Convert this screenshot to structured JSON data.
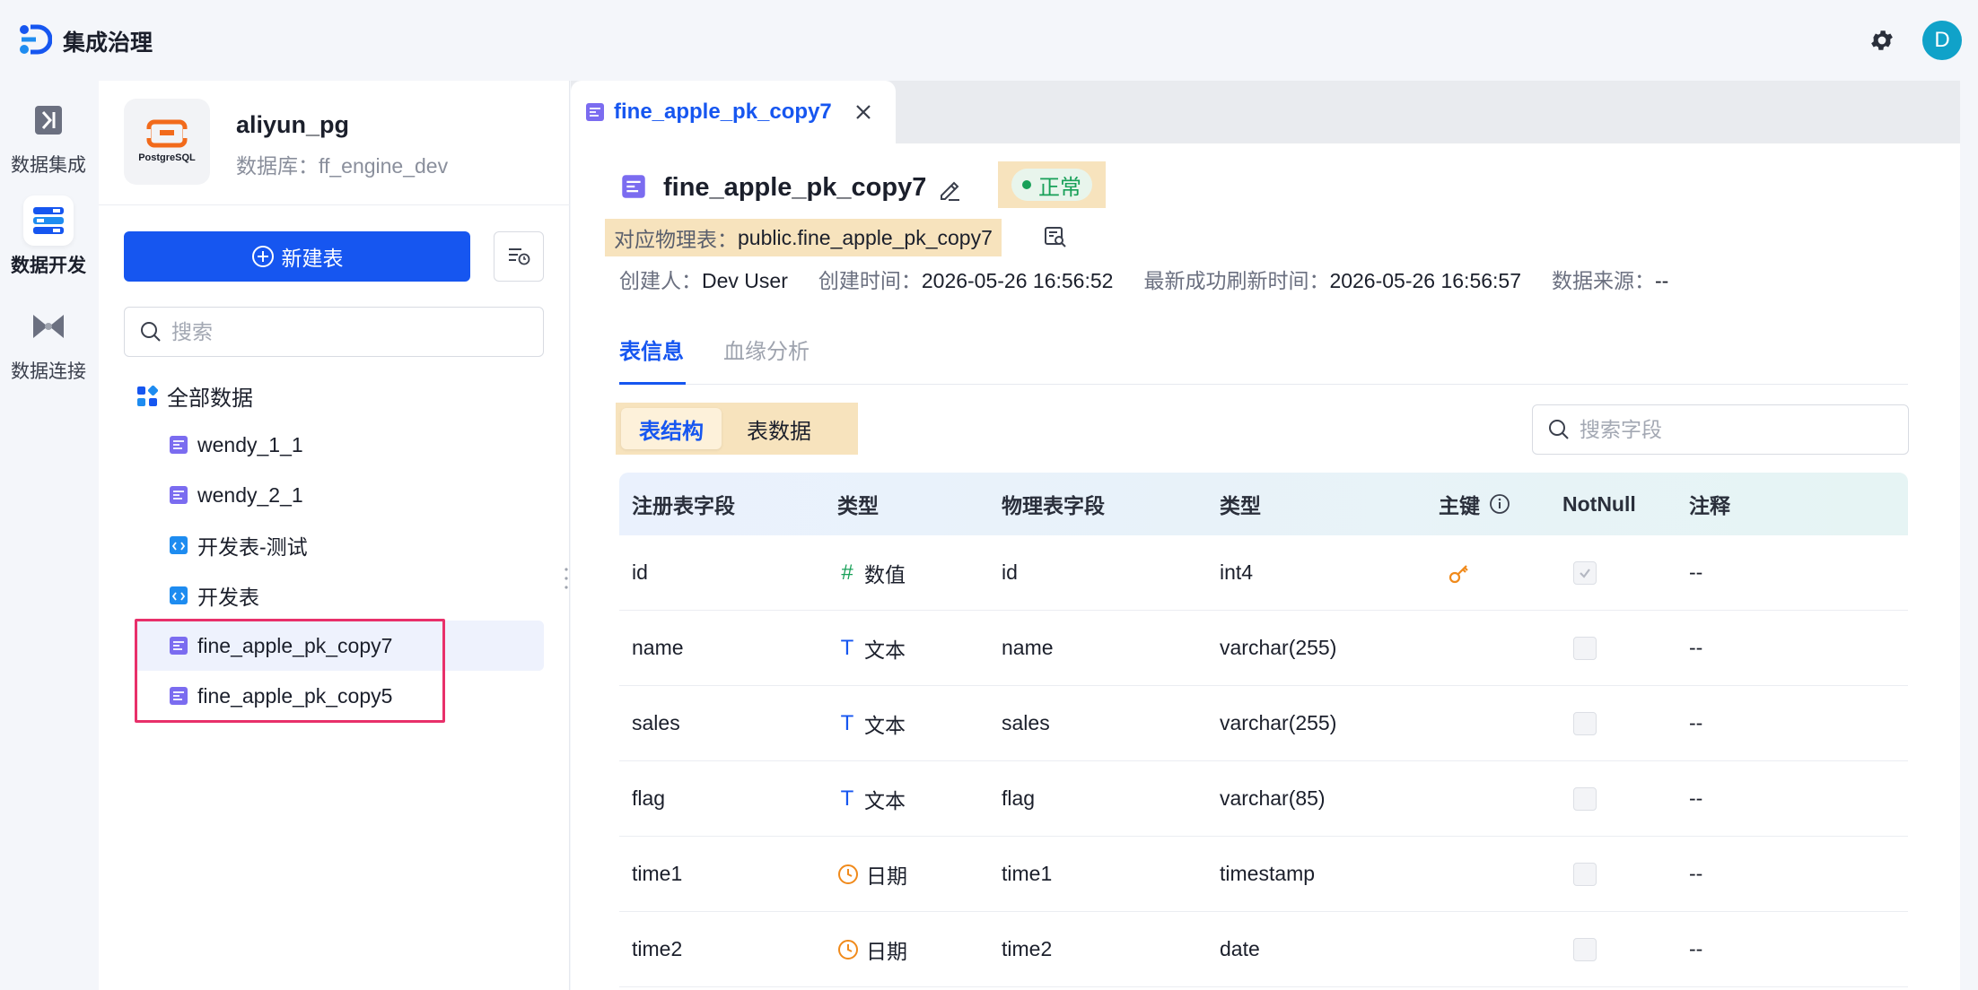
{
  "app": {
    "title": "集成治理",
    "avatar_letter": "D"
  },
  "rail": [
    {
      "label": "数据集成",
      "icon": "data-integration-icon"
    },
    {
      "label": "数据开发",
      "icon": "data-development-icon",
      "active": true
    },
    {
      "label": "数据连接",
      "icon": "data-connection-icon"
    }
  ],
  "datasource": {
    "logo_text": "PostgreSQL",
    "name": "aliyun_pg",
    "database": "数据库：ff_engine_dev"
  },
  "left": {
    "new_table_label": "新建表",
    "search_placeholder": "搜索",
    "root_label": "全部数据",
    "items": [
      {
        "label": "wendy_1_1",
        "kind": "table"
      },
      {
        "label": "wendy_2_1",
        "kind": "table"
      },
      {
        "label": "开发表-测试",
        "kind": "dev"
      },
      {
        "label": "开发表",
        "kind": "dev"
      },
      {
        "label": "fine_apple_pk_copy7",
        "kind": "table",
        "selected": true
      },
      {
        "label": "fine_apple_pk_copy5",
        "kind": "table"
      }
    ]
  },
  "tab": {
    "label": "fine_apple_pk_copy7"
  },
  "detail": {
    "title": "fine_apple_pk_copy7",
    "status": "正常",
    "physical_label": "对应物理表：",
    "physical_value": "public.fine_apple_pk_copy7",
    "meta": [
      {
        "k": "创建人：",
        "v": "Dev User"
      },
      {
        "k": "创建时间：",
        "v": "2026-05-26 16:56:52"
      },
      {
        "k": "最新成功刷新时间：",
        "v": "2026-05-26 16:56:57"
      },
      {
        "k": "数据来源：",
        "v": "--"
      }
    ],
    "tabs": [
      "表信息",
      "血缘分析"
    ],
    "segments": [
      "表结构",
      "表数据"
    ],
    "field_search_placeholder": "搜索字段"
  },
  "table": {
    "headers": [
      "注册表字段",
      "类型",
      "物理表字段",
      "类型",
      "主键",
      "NotNull",
      "注释"
    ],
    "rows": [
      {
        "field": "id",
        "type": "数值",
        "type_kind": "number",
        "phys": "id",
        "ptype": "int4",
        "pk": true,
        "notnull": true,
        "comment": "--"
      },
      {
        "field": "name",
        "type": "文本",
        "type_kind": "text",
        "phys": "name",
        "ptype": "varchar(255)",
        "pk": false,
        "notnull": false,
        "comment": "--"
      },
      {
        "field": "sales",
        "type": "文本",
        "type_kind": "text",
        "phys": "sales",
        "ptype": "varchar(255)",
        "pk": false,
        "notnull": false,
        "comment": "--"
      },
      {
        "field": "flag",
        "type": "文本",
        "type_kind": "text",
        "phys": "flag",
        "ptype": "varchar(85)",
        "pk": false,
        "notnull": false,
        "comment": "--"
      },
      {
        "field": "time1",
        "type": "日期",
        "type_kind": "date",
        "phys": "time1",
        "ptype": "timestamp",
        "pk": false,
        "notnull": false,
        "comment": "--"
      },
      {
        "field": "time2",
        "type": "日期",
        "type_kind": "date",
        "phys": "time2",
        "ptype": "date",
        "pk": false,
        "notnull": false,
        "comment": "--"
      }
    ]
  },
  "colors": {
    "primary": "#1656f0",
    "status_green": "#18a058",
    "highlight": "#f7e3bd",
    "selection_box": "#e8306a"
  }
}
